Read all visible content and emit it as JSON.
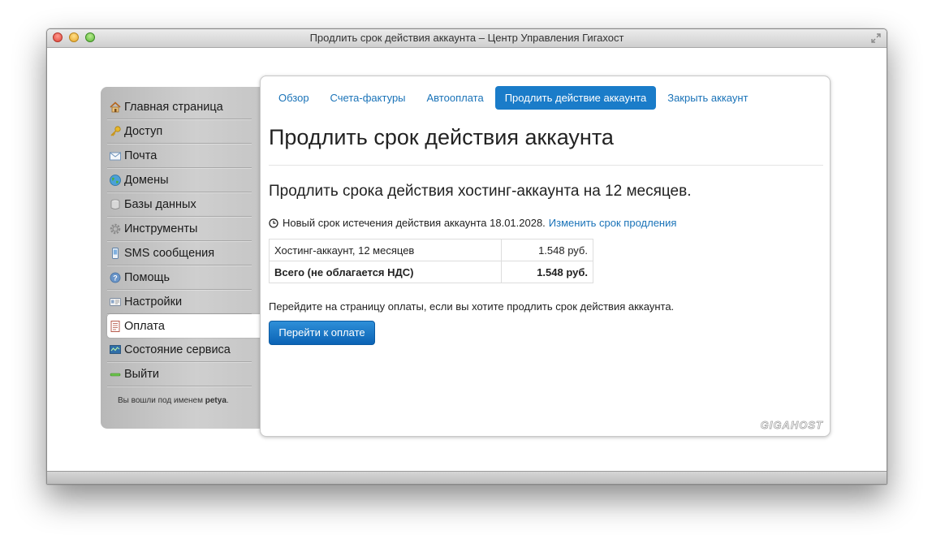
{
  "window": {
    "title": "Продлить срок действия аккаунта – Центр Управления Гигахост"
  },
  "sidebar": {
    "items": [
      {
        "label": "Главная страница",
        "icon": "home-icon"
      },
      {
        "label": "Доступ",
        "icon": "key-icon"
      },
      {
        "label": "Почта",
        "icon": "envelope-icon"
      },
      {
        "label": "Домены",
        "icon": "globe-icon"
      },
      {
        "label": "Базы данных",
        "icon": "database-icon"
      },
      {
        "label": "Инструменты",
        "icon": "gear-icon"
      },
      {
        "label": "SMS сообщения",
        "icon": "phone-icon"
      },
      {
        "label": "Помощь",
        "icon": "help-icon"
      },
      {
        "label": "Настройки",
        "icon": "id-card-icon"
      },
      {
        "label": "Оплата",
        "icon": "invoice-icon",
        "active": true
      },
      {
        "label": "Состояние сервиса",
        "icon": "monitor-icon"
      },
      {
        "label": "Выйти",
        "icon": "exit-icon"
      }
    ],
    "logged_in_prefix": "Вы вошли под именем",
    "username": "petya",
    "logged_in_suffix": "."
  },
  "tabs": [
    {
      "label": "Обзор"
    },
    {
      "label": "Счета-фактуры"
    },
    {
      "label": "Автооплата"
    },
    {
      "label": "Продлить действие аккаунта",
      "active": true
    },
    {
      "label": "Закрыть аккаунт"
    }
  ],
  "main": {
    "title": "Продлить срок действия аккаунта",
    "subtitle": "Продлить срока действия хостинг-аккаунта на 12 месяцев.",
    "expiry_text": "Новый срок истечения действия аккаунта 18.01.2028.",
    "change_link": "Изменить срок продления",
    "table": [
      {
        "name": "Хостинг-аккаунт, 12 месяцев",
        "amount": "1.548 руб."
      },
      {
        "name": "Всего (не облагается НДС)",
        "amount": "1.548 руб."
      }
    ],
    "instruction": "Перейдите на страницу оплаты, если вы хотите продлить срок действия аккаунта.",
    "pay_button": "Перейти к оплате",
    "logo": "GIGAHOST"
  },
  "colors": {
    "accent": "#1a7cc9",
    "link": "#1a73b8"
  }
}
